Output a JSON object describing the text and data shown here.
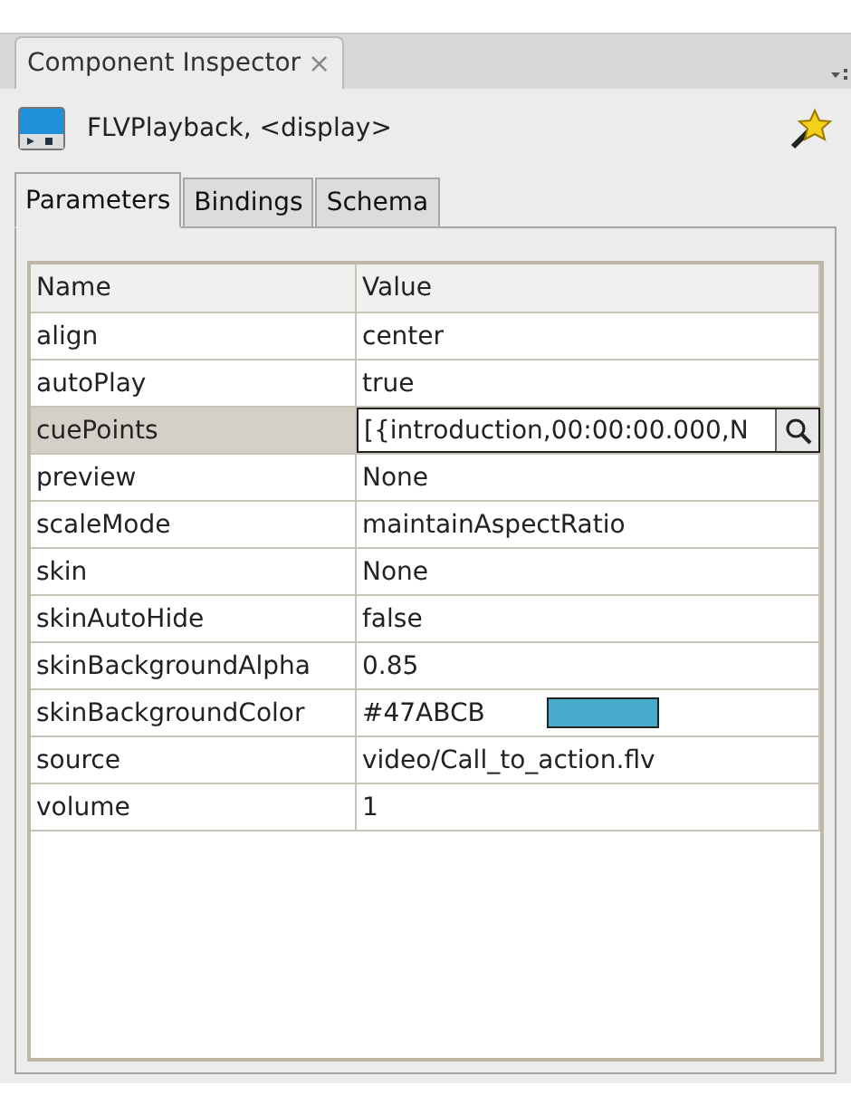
{
  "panel": {
    "title": "Component Inspector",
    "close": "×"
  },
  "component": {
    "label": "FLVPlayback, <display>"
  },
  "tabs": [
    {
      "label": "Parameters",
      "selected": true
    },
    {
      "label": "Bindings",
      "selected": false
    },
    {
      "label": "Schema",
      "selected": false
    }
  ],
  "table": {
    "columns": [
      "Name",
      "Value"
    ],
    "rows": [
      {
        "name": "align",
        "value": "center",
        "selected": false,
        "kind": "text"
      },
      {
        "name": "autoPlay",
        "value": "true",
        "selected": false,
        "kind": "text"
      },
      {
        "name": "cuePoints",
        "value": "[{introduction,00:00:00.000,N",
        "selected": true,
        "kind": "browse"
      },
      {
        "name": "preview",
        "value": "None",
        "selected": false,
        "kind": "text"
      },
      {
        "name": "scaleMode",
        "value": "maintainAspectRatio",
        "selected": false,
        "kind": "text"
      },
      {
        "name": "skin",
        "value": "None",
        "selected": false,
        "kind": "text"
      },
      {
        "name": "skinAutoHide",
        "value": "false",
        "selected": false,
        "kind": "text"
      },
      {
        "name": "skinBackgroundAlpha",
        "value": "0.85",
        "selected": false,
        "kind": "text"
      },
      {
        "name": "skinBackgroundColor",
        "value": "#47ABCB",
        "selected": false,
        "kind": "color",
        "color": "#47abcb"
      },
      {
        "name": "source",
        "value": "video/Call_to_action.flv",
        "selected": false,
        "kind": "text"
      },
      {
        "name": "volume",
        "value": "1",
        "selected": false,
        "kind": "text"
      }
    ]
  }
}
